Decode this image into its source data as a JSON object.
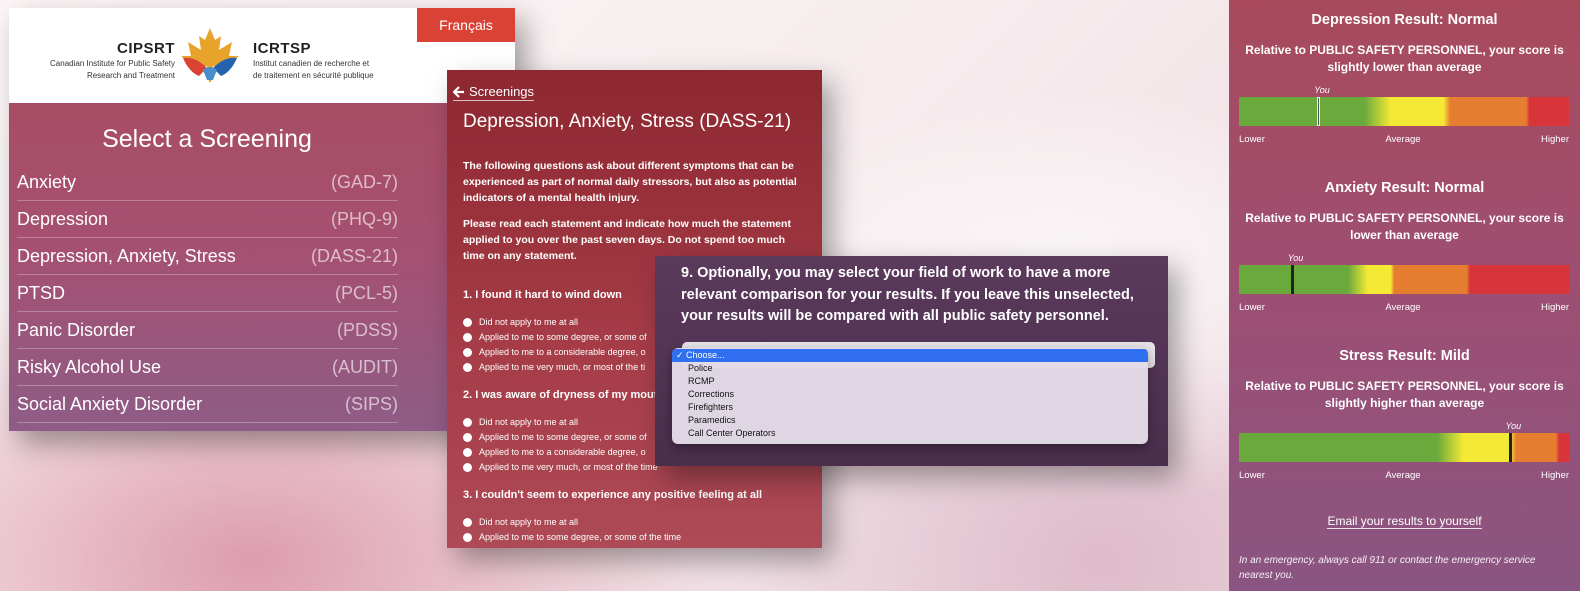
{
  "panel1": {
    "language_button": "Français",
    "logo_left": {
      "abbr": "CIPSRT",
      "sub_line1": "Canadian Institute for Public Safety",
      "sub_line2": "Research and Treatment"
    },
    "logo_right": {
      "abbr": "ICRTSP",
      "sub_line1": "Institut canadien de recherche et",
      "sub_line2": "de traitement en sécurité publique"
    },
    "title": "Select a Screening",
    "items": [
      {
        "label": "Anxiety",
        "code": "(GAD-7)"
      },
      {
        "label": "Depression",
        "code": "(PHQ-9)"
      },
      {
        "label": "Depression, Anxiety, Stress",
        "code": "(DASS-21)"
      },
      {
        "label": "PTSD",
        "code": "(PCL-5)"
      },
      {
        "label": "Panic Disorder",
        "code": "(PDSS)"
      },
      {
        "label": "Risky Alcohol Use",
        "code": "(AUDIT)"
      },
      {
        "label": "Social Anxiety Disorder",
        "code": "(SIPS)"
      }
    ]
  },
  "panel2": {
    "back_label": "Screenings",
    "title": "Depression, Anxiety, Stress (DASS-21)",
    "intro1": "The following questions ask about different symptoms that can be experienced as part of normal daily stressors, but also as potential indicators of a mental health injury.",
    "intro2": "Please read each statement and indicate how much the statement applied to you over the past seven days.  Do not spend too much time on any statement.",
    "questions": [
      {
        "title": "1. I found it hard to wind down",
        "options": [
          "Did not apply to me at all",
          "Applied to me to some degree, or some of",
          "Applied to me to a considerable degree, o",
          "Applied to me very much, or most of the ti"
        ]
      },
      {
        "title": "2. I was aware of dryness of my mout",
        "options": [
          "Did not apply to me at all",
          "Applied to me to some degree, or some of",
          "Applied to me to a considerable degree, o",
          "Applied to me very much, or most of the time"
        ]
      },
      {
        "title": "3. I couldn't seem to experience any positive feeling at all",
        "options": [
          "Did not apply to me at all",
          "Applied to me to some degree, or some of the time"
        ]
      }
    ]
  },
  "panel3": {
    "question": "9. Optionally, you may select your field of work to have a more relevant comparison for your results. If you leave this unselected, your results will be compared with all public safety personnel.",
    "dropdown_options": [
      "✓ Choose...",
      "Police",
      "RCMP",
      "Corrections",
      "Firefighters",
      "Paramedics",
      "Call Center Operators"
    ]
  },
  "panel4": {
    "results": [
      {
        "title": "Depression Result: Normal",
        "desc": "Relative to PUBLIC SAFETY PERSONNEL, your score is slightly lower than average",
        "you_pct": 0.24
      },
      {
        "title": "Anxiety Result: Normal",
        "desc": "Relative to PUBLIC SAFETY PERSONNEL, your score is lower than average",
        "you_pct": 0.16
      },
      {
        "title": "Stress Result: Mild",
        "desc": "Relative to PUBLIC SAFETY PERSONNEL, your score is slightly higher than average",
        "you_pct": 0.82
      }
    ],
    "you_label": "You",
    "scale_labels": {
      "lower": "Lower",
      "average": "Average",
      "higher": "Higher"
    },
    "email_link": "Email your results to yourself",
    "emergency_note": "In an emergency, always call 911 or contact the emergency service nearest you.",
    "colors": {
      "green": "#6aa93c",
      "yellow": "#f4e935",
      "orange": "#e57e30",
      "red": "#d8353a"
    }
  }
}
